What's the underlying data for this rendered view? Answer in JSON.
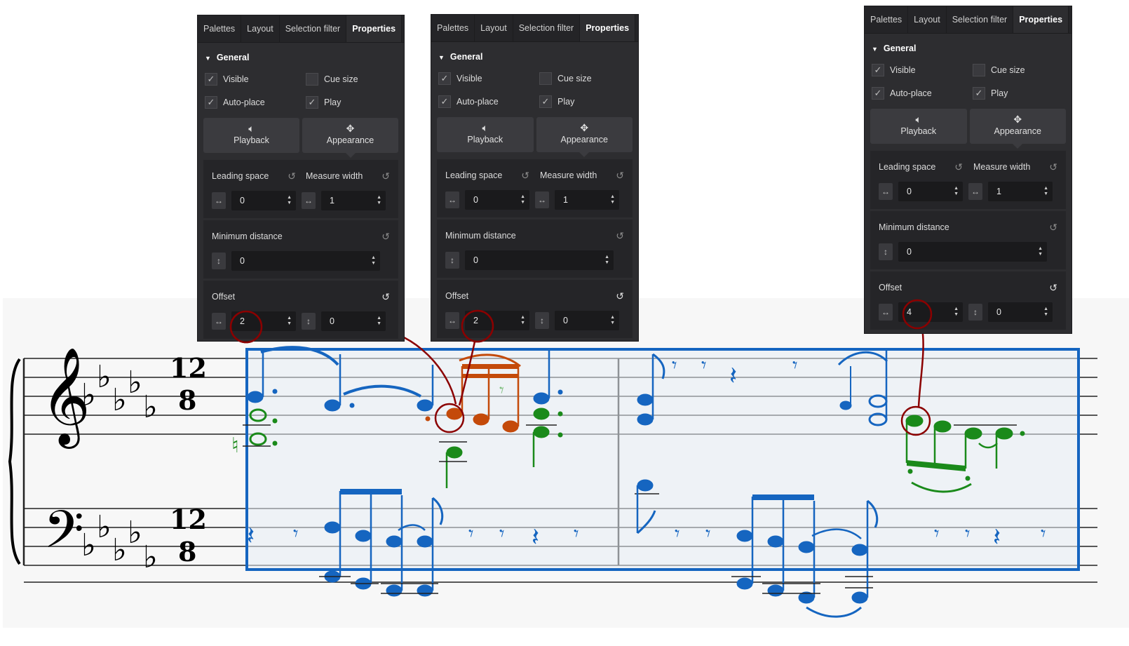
{
  "panel": {
    "tabs": [
      "Palettes",
      "Layout",
      "Selection filter",
      "Properties"
    ],
    "more": "···",
    "general": "General",
    "checks": [
      {
        "label": "Visible",
        "checked": true
      },
      {
        "label": "Cue size",
        "checked": false
      },
      {
        "label": "Auto-place",
        "checked": true
      },
      {
        "label": "Play",
        "checked": true
      }
    ],
    "modes": [
      {
        "label": "Playback",
        "icon": "speaker-icon"
      },
      {
        "label": "Appearance",
        "icon": "move-arrows-icon"
      }
    ],
    "leading_space_label": "Leading space",
    "leading_space_value": "0",
    "measure_width_label": "Measure width",
    "measure_width_value": "1",
    "min_distance_label": "Minimum distance",
    "min_distance_value": "0",
    "offset_label": "Offset",
    "offset_y_value": "0"
  },
  "panels": [
    {
      "offset_x": "2"
    },
    {
      "offset_x": "2"
    },
    {
      "offset_x": "4"
    }
  ],
  "score": {
    "time_signature_top": "12",
    "time_signature_bottom": "8",
    "colors": {
      "selection": "#1565c0",
      "green": "#1a8a1a",
      "orange": "#c44a0a",
      "highlight": "#8b0000"
    }
  }
}
